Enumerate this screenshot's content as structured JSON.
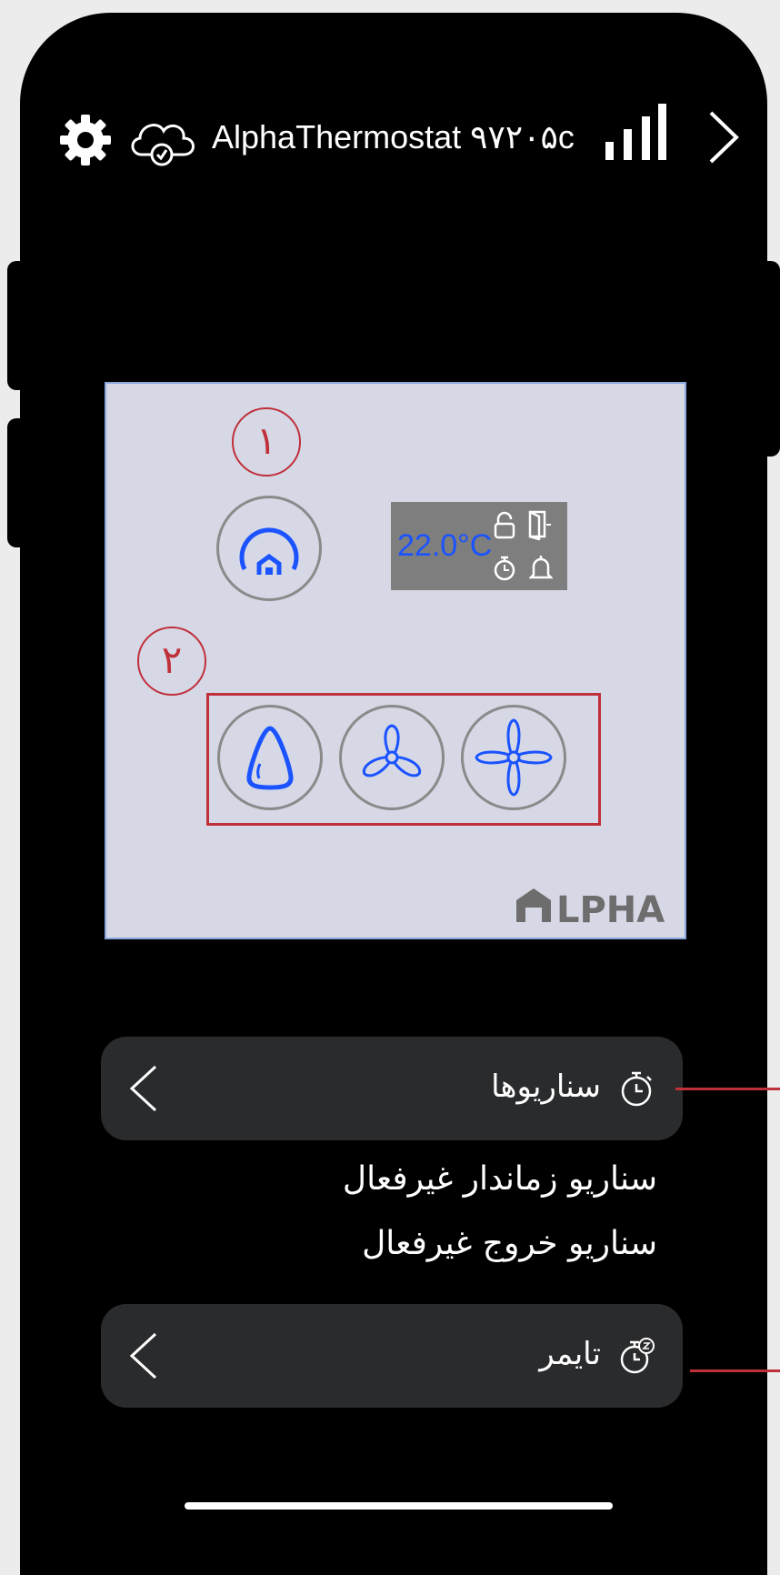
{
  "header": {
    "device_title": "AlphaThermostat ۹۷۲۰۵c",
    "icons": [
      "gear-icon",
      "cloud-check-icon",
      "signal-icon",
      "chevron-right-icon"
    ]
  },
  "panel": {
    "markers": [
      "۱",
      "۲"
    ],
    "display_temperature": "22.0°C",
    "display_icons": [
      "unlock-icon",
      "door-icon",
      "timer-icon",
      "bell-icon"
    ],
    "mode_buttons": [
      "home-mode-icon",
      "water-drop-icon",
      "fan-3-blade-icon",
      "fan-4-blade-icon"
    ],
    "logo_text": "LPHA"
  },
  "menu": {
    "scenarios_label": "سناریوها",
    "scenario_timed_status": "سناریو زماندار غیرفعال",
    "scenario_exit_status": "سناریو خروج غیرفعال",
    "timer_label": "تایمر"
  },
  "colors": {
    "accent_blue": "#1a53ff",
    "marker_red": "#c0303a",
    "panel_bg": "#d6d8e6",
    "row_bg": "#2a2b2d"
  }
}
